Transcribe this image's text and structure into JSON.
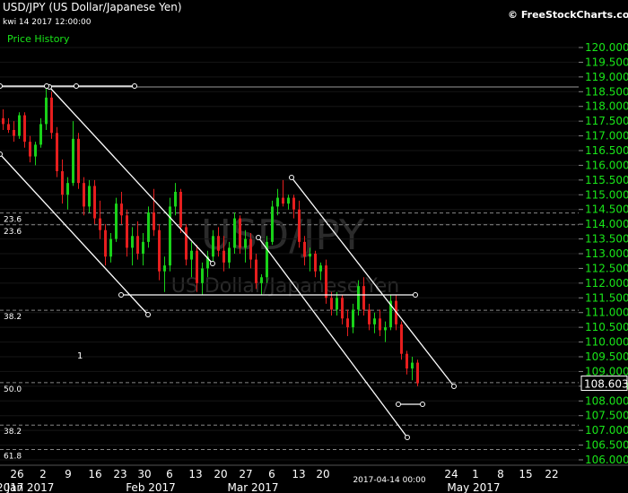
{
  "header": {
    "title": "USD/JPY (US Dollar/Japanese Yen)",
    "datetime": "kwi 14 2017 12:00:00",
    "price_history_label": "Price History",
    "credit": "© FreeStockCharts.com"
  },
  "watermark": {
    "symbol": "USD/JPY",
    "name": "US Dollar/Japanese Yen"
  },
  "colors": {
    "background": "#000000",
    "up_candle": "#19d219",
    "down_candle": "#e61e1e",
    "price_labels": "#19e619",
    "trendlines": "#ffffff",
    "fib_lines": "#b4b4b4"
  },
  "chart_data": {
    "type": "candlestick",
    "symbol": "USD/JPY",
    "timeframe": "daily",
    "ylim": [
      105.5,
      120.4
    ],
    "y_ticks": [
      "120.000",
      "119.500",
      "119.000",
      "118.500",
      "118.000",
      "117.500",
      "117.000",
      "116.500",
      "116.000",
      "115.500",
      "115.000",
      "114.500",
      "114.000",
      "113.500",
      "113.000",
      "112.500",
      "112.000",
      "111.500",
      "111.000",
      "110.500",
      "110.000",
      "109.500",
      "109.000",
      "108.500",
      "108.000",
      "107.500",
      "107.000",
      "106.500",
      "106.000"
    ],
    "x_day_ticks": [
      "26",
      "2",
      "9",
      "16",
      "23",
      "30",
      "6",
      "13",
      "20",
      "27",
      "6",
      "13",
      "20",
      "2017-04-14 00:00",
      "24",
      "1",
      "8",
      "15",
      "22"
    ],
    "x_month_labels": [
      "2017",
      "Jan 2017",
      "Feb 2017",
      "Mar 2017",
      "May 2017"
    ],
    "last_price": "108.603",
    "fib_levels": [
      {
        "label": "23.6",
        "price": 114.38
      },
      {
        "label": "23.6",
        "price": 113.98
      },
      {
        "label": "38.2",
        "price": 111.08
      },
      {
        "label": "50.0",
        "price": 108.62
      },
      {
        "label": "38.2",
        "price": 107.18
      },
      {
        "label": "61.8",
        "price": 106.35
      }
    ],
    "resistance_level": 118.66,
    "wave_label": "1",
    "candles": [
      {
        "o": 117.6,
        "h": 117.9,
        "l": 117.2,
        "c": 117.4
      },
      {
        "o": 117.4,
        "h": 117.6,
        "l": 117.1,
        "c": 117.2
      },
      {
        "o": 117.2,
        "h": 117.5,
        "l": 116.8,
        "c": 117.0
      },
      {
        "o": 117.0,
        "h": 117.8,
        "l": 116.9,
        "c": 117.7
      },
      {
        "o": 117.7,
        "h": 117.8,
        "l": 116.6,
        "c": 116.8
      },
      {
        "o": 116.8,
        "h": 117.0,
        "l": 116.1,
        "c": 116.3
      },
      {
        "o": 116.3,
        "h": 116.8,
        "l": 116.0,
        "c": 116.7
      },
      {
        "o": 116.7,
        "h": 117.6,
        "l": 116.6,
        "c": 117.4
      },
      {
        "o": 117.4,
        "h": 118.6,
        "l": 117.2,
        "c": 118.3
      },
      {
        "o": 118.3,
        "h": 118.5,
        "l": 116.9,
        "c": 117.1
      },
      {
        "o": 117.1,
        "h": 117.3,
        "l": 115.6,
        "c": 115.8
      },
      {
        "o": 115.8,
        "h": 116.2,
        "l": 114.7,
        "c": 115.0
      },
      {
        "o": 115.0,
        "h": 115.6,
        "l": 114.5,
        "c": 115.4
      },
      {
        "o": 115.4,
        "h": 117.5,
        "l": 115.3,
        "c": 116.9
      },
      {
        "o": 116.9,
        "h": 117.1,
        "l": 115.2,
        "c": 115.4
      },
      {
        "o": 115.4,
        "h": 115.6,
        "l": 114.3,
        "c": 114.6
      },
      {
        "o": 114.6,
        "h": 115.5,
        "l": 114.4,
        "c": 115.3
      },
      {
        "o": 115.3,
        "h": 115.5,
        "l": 114.0,
        "c": 114.2
      },
      {
        "o": 114.2,
        "h": 114.8,
        "l": 113.5,
        "c": 113.8
      },
      {
        "o": 113.8,
        "h": 114.0,
        "l": 112.6,
        "c": 112.9
      },
      {
        "o": 112.9,
        "h": 113.7,
        "l": 112.7,
        "c": 113.5
      },
      {
        "o": 113.5,
        "h": 114.9,
        "l": 113.4,
        "c": 114.7
      },
      {
        "o": 114.7,
        "h": 115.1,
        "l": 114.0,
        "c": 114.3
      },
      {
        "o": 114.3,
        "h": 114.5,
        "l": 112.9,
        "c": 113.2
      },
      {
        "o": 113.2,
        "h": 113.9,
        "l": 112.6,
        "c": 113.6
      },
      {
        "o": 113.6,
        "h": 114.1,
        "l": 112.8,
        "c": 113.0
      },
      {
        "o": 113.0,
        "h": 113.7,
        "l": 112.6,
        "c": 113.4
      },
      {
        "o": 113.4,
        "h": 114.6,
        "l": 113.2,
        "c": 114.4
      },
      {
        "o": 114.4,
        "h": 115.2,
        "l": 113.6,
        "c": 113.8
      },
      {
        "o": 113.8,
        "h": 114.0,
        "l": 112.1,
        "c": 112.4
      },
      {
        "o": 112.4,
        "h": 112.9,
        "l": 111.7,
        "c": 112.6
      },
      {
        "o": 112.6,
        "h": 114.9,
        "l": 112.4,
        "c": 114.6
      },
      {
        "o": 114.6,
        "h": 115.4,
        "l": 114.3,
        "c": 115.1
      },
      {
        "o": 115.1,
        "h": 115.2,
        "l": 113.7,
        "c": 113.9
      },
      {
        "o": 113.9,
        "h": 114.0,
        "l": 112.6,
        "c": 112.8
      },
      {
        "o": 112.8,
        "h": 113.4,
        "l": 112.2,
        "c": 113.1
      },
      {
        "o": 113.1,
        "h": 113.3,
        "l": 111.7,
        "c": 112.0
      },
      {
        "o": 112.0,
        "h": 112.7,
        "l": 111.6,
        "c": 112.5
      },
      {
        "o": 112.5,
        "h": 113.1,
        "l": 112.2,
        "c": 112.9
      },
      {
        "o": 112.9,
        "h": 113.8,
        "l": 112.7,
        "c": 113.6
      },
      {
        "o": 113.6,
        "h": 113.9,
        "l": 112.9,
        "c": 113.1
      },
      {
        "o": 113.1,
        "h": 113.6,
        "l": 112.4,
        "c": 112.7
      },
      {
        "o": 112.7,
        "h": 113.4,
        "l": 112.5,
        "c": 113.2
      },
      {
        "o": 113.2,
        "h": 114.4,
        "l": 113.0,
        "c": 114.2
      },
      {
        "o": 114.2,
        "h": 114.3,
        "l": 113.0,
        "c": 113.2
      },
      {
        "o": 113.2,
        "h": 113.8,
        "l": 112.7,
        "c": 113.5
      },
      {
        "o": 113.5,
        "h": 113.7,
        "l": 112.5,
        "c": 112.8
      },
      {
        "o": 112.8,
        "h": 113.0,
        "l": 111.8,
        "c": 112.0
      },
      {
        "o": 112.0,
        "h": 112.3,
        "l": 111.6,
        "c": 112.2
      },
      {
        "o": 112.2,
        "h": 113.6,
        "l": 112.0,
        "c": 113.4
      },
      {
        "o": 113.4,
        "h": 114.8,
        "l": 113.3,
        "c": 114.6
      },
      {
        "o": 114.6,
        "h": 115.2,
        "l": 114.3,
        "c": 114.9
      },
      {
        "o": 114.9,
        "h": 115.5,
        "l": 114.6,
        "c": 114.7
      },
      {
        "o": 114.7,
        "h": 115.0,
        "l": 114.5,
        "c": 114.9
      },
      {
        "o": 114.9,
        "h": 115.0,
        "l": 114.2,
        "c": 114.5
      },
      {
        "o": 114.5,
        "h": 114.8,
        "l": 113.2,
        "c": 113.4
      },
      {
        "o": 113.4,
        "h": 113.6,
        "l": 112.6,
        "c": 112.9
      },
      {
        "o": 112.9,
        "h": 113.2,
        "l": 112.4,
        "c": 113.0
      },
      {
        "o": 113.0,
        "h": 113.1,
        "l": 112.2,
        "c": 112.4
      },
      {
        "o": 112.4,
        "h": 112.7,
        "l": 112.1,
        "c": 112.6
      },
      {
        "o": 112.6,
        "h": 112.8,
        "l": 111.3,
        "c": 111.5
      },
      {
        "o": 111.5,
        "h": 111.7,
        "l": 110.9,
        "c": 111.1
      },
      {
        "o": 111.1,
        "h": 111.7,
        "l": 110.9,
        "c": 111.5
      },
      {
        "o": 111.5,
        "h": 111.6,
        "l": 110.6,
        "c": 110.8
      },
      {
        "o": 110.8,
        "h": 111.1,
        "l": 110.2,
        "c": 110.5
      },
      {
        "o": 110.5,
        "h": 111.3,
        "l": 110.3,
        "c": 111.1
      },
      {
        "o": 111.1,
        "h": 112.1,
        "l": 110.9,
        "c": 111.9
      },
      {
        "o": 111.9,
        "h": 112.2,
        "l": 110.9,
        "c": 111.1
      },
      {
        "o": 111.1,
        "h": 111.3,
        "l": 110.4,
        "c": 110.6
      },
      {
        "o": 110.6,
        "h": 111.0,
        "l": 110.3,
        "c": 110.8
      },
      {
        "o": 110.8,
        "h": 111.1,
        "l": 110.2,
        "c": 110.4
      },
      {
        "o": 110.4,
        "h": 110.7,
        "l": 110.0,
        "c": 110.5
      },
      {
        "o": 110.5,
        "h": 111.6,
        "l": 110.4,
        "c": 111.4
      },
      {
        "o": 111.4,
        "h": 111.6,
        "l": 110.4,
        "c": 110.6
      },
      {
        "o": 110.6,
        "h": 110.7,
        "l": 109.4,
        "c": 109.6
      },
      {
        "o": 109.6,
        "h": 109.7,
        "l": 108.9,
        "c": 109.1
      },
      {
        "o": 109.1,
        "h": 109.5,
        "l": 108.7,
        "c": 109.3
      },
      {
        "o": 109.3,
        "h": 109.4,
        "l": 108.5,
        "c": 108.6
      }
    ]
  }
}
